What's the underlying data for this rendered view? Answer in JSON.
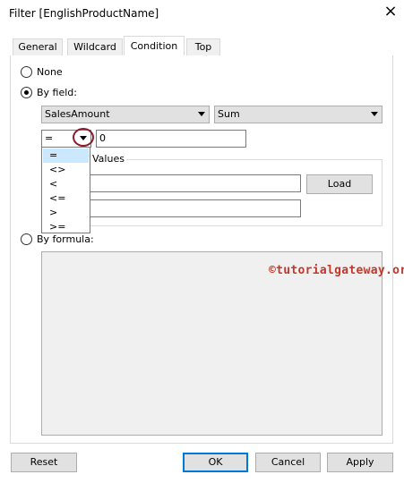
{
  "window": {
    "title": "Filter [EnglishProductName]",
    "close_icon": "×"
  },
  "tabs": [
    {
      "label": "General"
    },
    {
      "label": "Wildcard"
    },
    {
      "label": "Condition",
      "active": true
    },
    {
      "label": "Top"
    }
  ],
  "options": {
    "none_label": "None",
    "by_field_label": "By field:",
    "by_formula_label": "By formula:",
    "selected": "by_field"
  },
  "by_field": {
    "field_value": "SalesAmount",
    "aggregate_value": "Sum",
    "operator_value": "=",
    "value_input": "0",
    "operator_options": [
      "=",
      "<>",
      "<",
      "<=",
      ">",
      ">="
    ]
  },
  "values_group": {
    "label": "Values",
    "load_button": "Load"
  },
  "watermark": "©tutorialgateway.org",
  "footer": {
    "reset": "Reset",
    "ok": "OK",
    "cancel": "Cancel",
    "apply": "Apply"
  },
  "colors": {
    "accent": "#0078d7",
    "highlight": "#cce8ff",
    "annotation": "#8b1a2b"
  }
}
